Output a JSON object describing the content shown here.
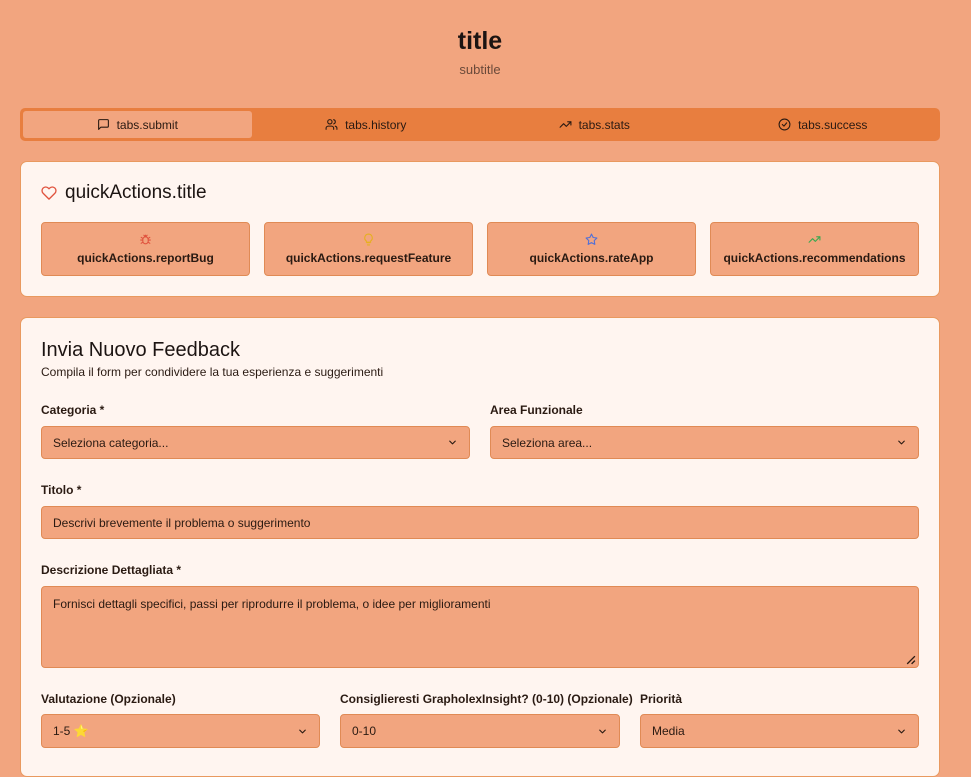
{
  "header": {
    "title": "title",
    "subtitle": "subtitle"
  },
  "tabs": [
    {
      "label": "tabs.submit",
      "icon": "message-square-icon",
      "active": true
    },
    {
      "label": "tabs.history",
      "icon": "users-icon",
      "active": false
    },
    {
      "label": "tabs.stats",
      "icon": "trending-up-icon",
      "active": false
    },
    {
      "label": "tabs.success",
      "icon": "check-circle-icon",
      "active": false
    }
  ],
  "quick_actions": {
    "title": "quickActions.title",
    "title_icon": "heart-icon",
    "items": [
      {
        "label": "quickActions.reportBug",
        "icon": "bug-icon",
        "color": "#e0533e"
      },
      {
        "label": "quickActions.requestFeature",
        "icon": "lightbulb-icon",
        "color": "#e6b020"
      },
      {
        "label": "quickActions.rateApp",
        "icon": "star-icon",
        "color": "#4f6fd8"
      },
      {
        "label": "quickActions.recommendations",
        "icon": "trending-up-icon",
        "color": "#3aa84f"
      }
    ]
  },
  "form": {
    "title": "Invia Nuovo Feedback",
    "description": "Compila il form per condividere la tua esperienza e suggerimenti",
    "category": {
      "label": "Categoria *",
      "value": "Seleziona categoria..."
    },
    "area": {
      "label": "Area Funzionale",
      "value": "Seleziona area..."
    },
    "subject": {
      "label": "Titolo *",
      "placeholder": "Descrivi brevemente il problema o suggerimento"
    },
    "details": {
      "label": "Descrizione Dettagliata *",
      "placeholder": "Fornisci dettagli specifici, passi per riprodurre il problema, o idee per miglioramenti"
    },
    "rating": {
      "label": "Valutazione (Opzionale)",
      "value": "1-5 ⭐"
    },
    "nps": {
      "label": "Consiglieresti GrapholexInsight? (0-10) (Opzionale)",
      "value": "0-10"
    },
    "priority": {
      "label": "Priorità",
      "value": "Media"
    }
  },
  "colors": {
    "background": "#f2a57f",
    "accent": "#e87e3f",
    "card": "#fff5f0",
    "border": "#e9995f"
  }
}
